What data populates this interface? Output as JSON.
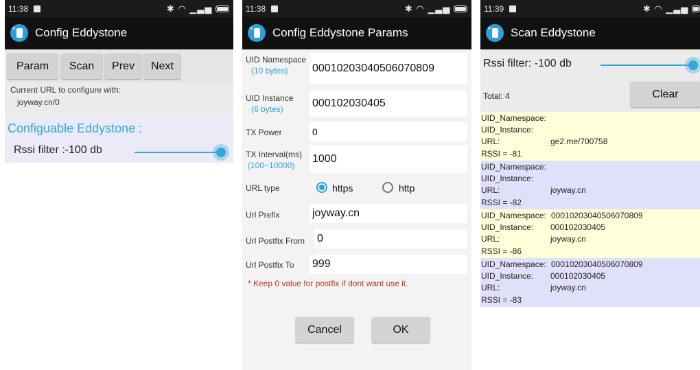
{
  "screens": [
    {
      "status": {
        "time": "11:38"
      },
      "appbar": {
        "title": "Config Eddystone"
      },
      "buttons": [
        "Param",
        "Scan",
        "Prev",
        "Next"
      ],
      "url_info": {
        "label": "Current URL to configure with:",
        "value": "joyway.cn/0"
      },
      "config": {
        "heading": "Configuable Eddystone :",
        "rssi_label": "Rssi filter :-100 db",
        "slider_level": 1.0
      }
    },
    {
      "status": {
        "time": "11:38"
      },
      "appbar": {
        "title": "Config Eddystone Params"
      },
      "fields": [
        {
          "label": "UID Namespace",
          "hint": "(10 bytes)",
          "value": "00010203040506070809"
        },
        {
          "label": "UID Instance",
          "hint": "(6 bytes)",
          "value": "000102030405"
        },
        {
          "label": "TX Power",
          "hint": "",
          "value": "0"
        },
        {
          "label": "TX Interval(ms)",
          "hint": "(100~10000)",
          "value": "1000"
        },
        {
          "label": "Url Prefix",
          "hint": "",
          "value": "joyway.cn"
        },
        {
          "label": "Url Postfix From",
          "hint": "",
          "value": "0"
        },
        {
          "label": "Url Postfix To",
          "hint": "",
          "value": "999"
        }
      ],
      "url_type": {
        "label": "URL type",
        "options": [
          "https",
          "http"
        ],
        "selected": "https"
      },
      "note": "* Keep 0 value for postfix if dont want use it.",
      "cancel_label": "Cancel",
      "ok_label": "OK"
    },
    {
      "status": {
        "time": "11:39"
      },
      "appbar": {
        "title": "Scan Eddystone"
      },
      "rssi_label": "Rssi filter: -100 db",
      "slider_level": 1.0,
      "total": "Total: 4",
      "clear_label": "Clear",
      "keys": {
        "ns": "UID_Namespace:",
        "inst": "UID_Instance:",
        "url": "URL:"
      },
      "results": [
        {
          "ns": "",
          "inst": "",
          "url": "ge2.me/700758",
          "rssi": "RSSI = -81",
          "color": "#ffffd9"
        },
        {
          "ns": "",
          "inst": "",
          "url": "joyway.cn",
          "rssi": "RSSI = -82",
          "color": "#e0e0fa"
        },
        {
          "ns": "00010203040506070809",
          "inst": "000102030405",
          "url": "joyway.cn",
          "rssi": "RSSI = -86",
          "color": "#ffffd9"
        },
        {
          "ns": "00010203040506070809",
          "inst": "000102030405",
          "url": "joyway.cn",
          "rssi": "RSSI = -83",
          "color": "#e0e0fa"
        }
      ]
    }
  ]
}
